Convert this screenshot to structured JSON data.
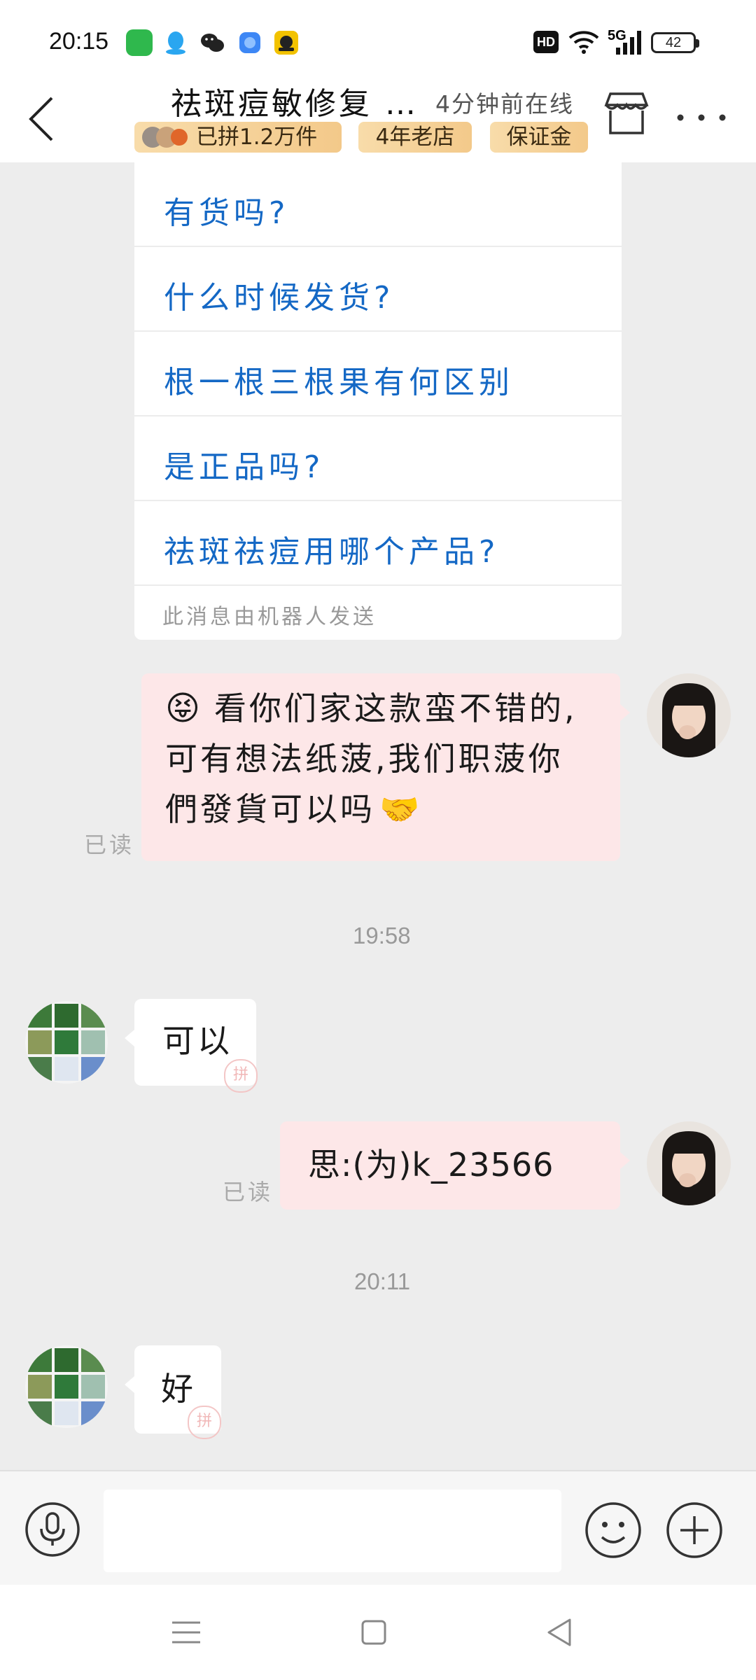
{
  "status_bar": {
    "time": "20:15",
    "network": "5G",
    "hd": "HD",
    "battery": "42"
  },
  "header": {
    "title": "祛斑痘敏修复 …",
    "online_status": "4分钟前在线",
    "badges": {
      "sales": "已拼1.2万件",
      "years": "4年老店",
      "deposit": "保证金"
    }
  },
  "bot_card": {
    "faq": [
      "有货吗?",
      "什么时候发货?",
      "根一根三根果有何区别",
      "是正品吗?",
      "祛斑祛痘用哪个产品?"
    ],
    "note": "此消息由机器人发送"
  },
  "messages": {
    "m1": {
      "emoji": "😝",
      "line1": "看你们家这款蛮不错的,",
      "line2": "可有想法纸菠,我们职菠你",
      "line3": "們發貨可以吗",
      "emoji_end": "🤝",
      "read": "已读"
    },
    "t1": "19:58",
    "m2": {
      "text": "可以",
      "stamp": "拼"
    },
    "m3": {
      "text": "思:(为)k_23566",
      "read": "已读"
    },
    "t2": "20:11",
    "m4": {
      "text": "好",
      "stamp": "拼"
    }
  },
  "input": {
    "placeholder": ""
  },
  "colors": {
    "faq_link": "#1468c5",
    "my_bubble": "#fde7e8",
    "badge_gold": "#f3c98a",
    "chat_bg": "#ededed"
  }
}
